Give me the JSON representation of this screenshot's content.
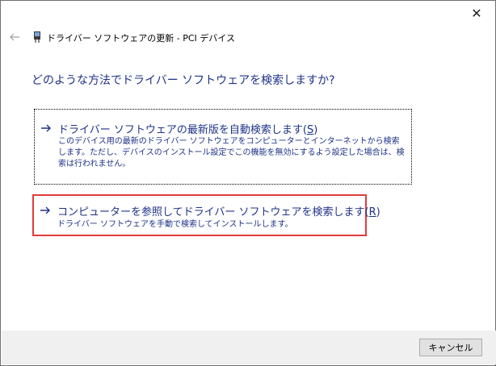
{
  "window": {
    "title": "ドライバー ソフトウェアの更新 - PCI デバイス",
    "close_glyph": "✕"
  },
  "main": {
    "question": "どのような方法でドライバー ソフトウェアを検索しますか?"
  },
  "options": [
    {
      "title_main": "ドライバー ソフトウェアの最新版を自動検索します(",
      "title_key": "S",
      "title_end": ")",
      "description": "このデバイス用の最新のドライバー ソフトウェアをコンピューターとインターネットから検索します。ただし、デバイスのインストール設定でこの機能を無効にするよう設定した場合は、検索は行われません。"
    },
    {
      "title_main": "コンピューターを参照してドライバー ソフトウェアを検索します(",
      "title_key": "R",
      "title_end": ")",
      "description": "ドライバー ソフトウェアを手動で検索してインストールします。"
    }
  ],
  "footer": {
    "cancel_label": "キャンセル"
  },
  "colors": {
    "link_blue": "#1e3287",
    "highlight_red": "#e03c3c",
    "footer_bg": "#f0f0f0"
  },
  "icons": {
    "back": "back-arrow-icon",
    "device": "device-icon",
    "option_arrow": "right-arrow-icon",
    "close": "close-icon"
  }
}
